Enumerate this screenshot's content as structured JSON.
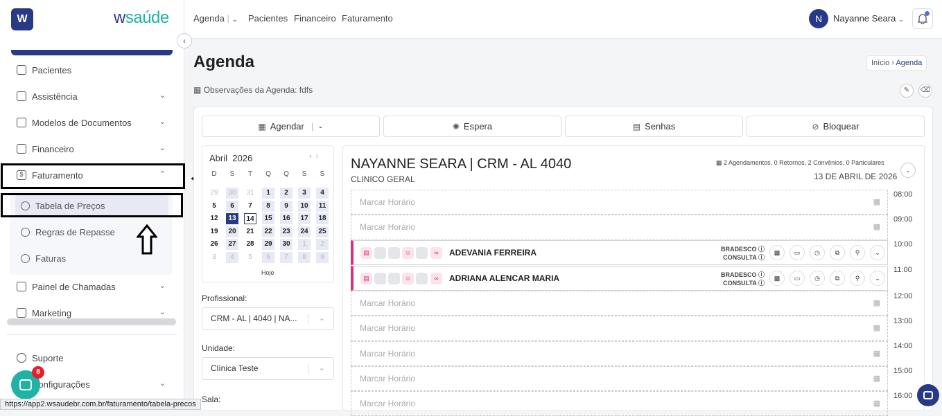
{
  "brand": {
    "logo_letter": "W",
    "name_part1": "w",
    "name_part2": "saúde"
  },
  "sidebar": {
    "items": [
      {
        "label": "Pacientes"
      },
      {
        "label": "Assistência"
      },
      {
        "label": "Modelos de Documentos"
      },
      {
        "label": "Financeiro"
      },
      {
        "label": "Faturamento"
      },
      {
        "label": "Painel de Chamadas"
      },
      {
        "label": "Marketing"
      },
      {
        "label": "Suporte"
      },
      {
        "label": "Configurações"
      }
    ],
    "sub_items": [
      {
        "label": "Tabela de Preços"
      },
      {
        "label": "Regras de Repasse"
      },
      {
        "label": "Faturas"
      }
    ],
    "chat_badge": "8"
  },
  "status_url": "https://app2.wsaudebr.com.br/faturamento/tabela-precos",
  "topnav": {
    "agenda": "Agenda",
    "pacientes": "Pacientes",
    "financeiro": "Financeiro",
    "faturamento": "Faturamento",
    "user_initial": "N",
    "user_name": "Nayanne Seara"
  },
  "page": {
    "title": "Agenda",
    "crumb_home": "Início",
    "crumb_current": "Agenda",
    "obs": "Observações da Agenda: fdfs"
  },
  "actions": {
    "agendar": "Agendar",
    "espera": "Espera",
    "senhas": "Senhas",
    "bloquear": "Bloquear"
  },
  "calendar": {
    "month": "Abril",
    "year": "2026",
    "weekdays": [
      "D",
      "S",
      "T",
      "Q",
      "Q",
      "S",
      "S"
    ],
    "weeks": [
      [
        "29",
        "30",
        "31",
        "1",
        "2",
        "3",
        "4"
      ],
      [
        "5",
        "6",
        "7",
        "8",
        "9",
        "10",
        "11"
      ],
      [
        "12",
        "13",
        "14",
        "15",
        "16",
        "17",
        "18"
      ],
      [
        "19",
        "20",
        "21",
        "22",
        "23",
        "24",
        "25"
      ],
      [
        "26",
        "27",
        "28",
        "29",
        "30",
        "1",
        "2"
      ],
      [
        "3",
        "4",
        "5",
        "6",
        "7",
        "8",
        "9"
      ]
    ],
    "today_label": "Hoje"
  },
  "filters": {
    "profissional_label": "Profissional:",
    "profissional_value": "CRM - AL | 4040 | NA...",
    "unidade_label": "Unidade:",
    "unidade_value": "Clínica Teste",
    "sala_label": "Sala:"
  },
  "schedule": {
    "doctor": "NAYANNE SEARA | CRM - AL 4040",
    "specialty": "CLINICO GERAL",
    "summary": "2 Agendamentos, 0 Retornos, 2 Convênios, 0 Particulares",
    "date": "13 DE ABRIL DE 2026",
    "empty_slot": "Marcar Horário",
    "appointments": [
      {
        "patient": "ADEVANIA FERREIRA",
        "insurance": "BRADESCO",
        "type": "CONSULTA"
      },
      {
        "patient": "ADRIANA ALENCAR MARIA",
        "insurance": "BRADESCO",
        "type": "CONSULTA"
      }
    ],
    "hours": [
      "08:00",
      "09:00",
      "10:00",
      "11:00",
      "12:00",
      "13:00",
      "14:00",
      "15:00",
      "16:00"
    ]
  },
  "colors": {
    "primary": "#283a86",
    "accent": "#20b3a5",
    "appointment": "#d8327c",
    "badge": "#e41f2d"
  }
}
